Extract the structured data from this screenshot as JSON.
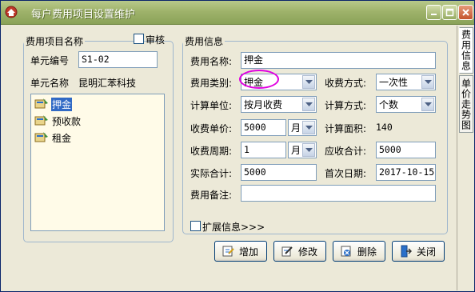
{
  "window": {
    "title": "每户费用项目设置维护"
  },
  "left_panel": {
    "legend": "费用项目名称",
    "audit_label": "审核",
    "unit_no_label": "单元编号",
    "unit_no_value": "S1-02",
    "unit_name_label": "单元名称",
    "unit_name_value": "昆明汇苯科技",
    "items": [
      {
        "label": "押金",
        "selected": true
      },
      {
        "label": "预收款",
        "selected": false
      },
      {
        "label": "租金",
        "selected": false
      }
    ]
  },
  "fee_info": {
    "legend": "费用信息",
    "name_label": "费用名称:",
    "name_value": "押金",
    "type_label": "费用类别:",
    "type_value": "押金",
    "collect_mode_label": "收费方式:",
    "collect_mode_value": "一次性",
    "calc_unit_label": "计算单位:",
    "calc_unit_value": "按月收费",
    "calc_mode_label": "计算方式:",
    "calc_mode_value": "个数",
    "unit_price_label": "收费单价:",
    "unit_price_value": "5000",
    "unit_price_unit": "月",
    "area_label": "计算面积:",
    "area_value": "140",
    "period_label": "收费周期:",
    "period_value": "1",
    "period_unit": "月",
    "receivable_label": "应收合计:",
    "receivable_value": "5000",
    "actual_label": "实际合计:",
    "actual_value": "5000",
    "first_date_label": "首次日期:",
    "first_date_value": "2017-10-15",
    "remark_label": "费用备注:",
    "remark_value": ""
  },
  "extend": {
    "label": "扩展信息>>>"
  },
  "buttons": {
    "add": "增加",
    "edit": "修改",
    "delete": "删除",
    "close": "关闭"
  },
  "side_tabs": [
    "费用信息",
    "单价走势图"
  ],
  "colors": {
    "title_bar": "#9fb36b",
    "selection": "#316ac5",
    "highlight_ring": "#e000e0",
    "list_bg": "#fffbe8"
  }
}
